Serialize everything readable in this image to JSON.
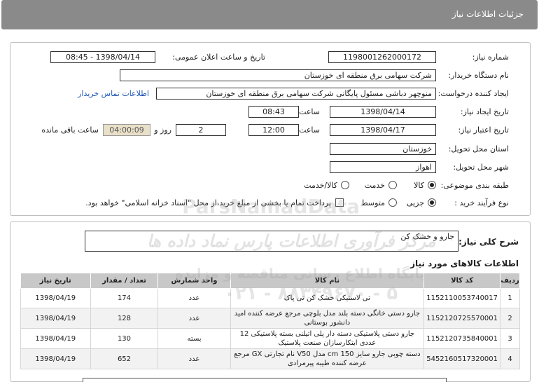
{
  "header": {
    "title": "جزئیات اطلاعات نیاز"
  },
  "form": {
    "need_number_label": "شماره نیاز:",
    "need_number": "1198001262000172",
    "announce_label": "تاریخ و ساعت اعلان عمومی:",
    "announce_value": "1398/04/14 - 08:45",
    "buyer_label": "نام دستگاه خریدار:",
    "buyer_value": "شرکت سهامی برق منطقه ای خوزستان",
    "creator_label": "ایجاد کننده درخواست:",
    "creator_value": "منوچهر دباشی مسئول پایگانی شرکت سهامی برق منطقه ای خوزستان",
    "contact_link": "اطلاعات تماس خریدار",
    "create_date_label": "تاریخ ایجاد نیاز:",
    "create_date": "1398/04/14",
    "time_label": "ساعت",
    "create_time": "08:43",
    "valid_label": "تاریخ اعتبار نیاز:",
    "valid_date": "1398/04/17",
    "valid_time": "12:00",
    "days_value": "2",
    "days_label": "روز و",
    "remaining_value": "04:00:09",
    "remaining_label": "ساعت باقی مانده",
    "province_label": "استان محل تحویل:",
    "province_value": "خوزستان",
    "city_label": "شهر محل تحویل:",
    "city_value": "اهواز",
    "category_label": "طبقه بندی موضوعی:",
    "category_options": [
      "کالا",
      "خدمت",
      "کالا/خدمت"
    ],
    "process_label": "نوع فرآیند خرید :",
    "process_options": [
      "جزیی",
      "متوسط"
    ],
    "payment_note": "پرداخت تمام یا بخشی از مبلغ خرید،از محل \"اسناد خزانه اسلامی\" خواهد بود."
  },
  "summary": {
    "label": "شرح کلی نیاز:",
    "value": "جارو و خشک کن"
  },
  "items_section": {
    "title": "اطلاعات کالاهای مورد نیاز",
    "columns": [
      "ردیف",
      "کد کالا",
      "نام کالا",
      "واحد شمارش",
      "تعداد / مقدار",
      "تاریخ نیاز"
    ],
    "rows": [
      [
        "1",
        "1152110053740017",
        "تی لاستیکی خشک کن تی پاک",
        "عدد",
        "174",
        "1398/04/19"
      ],
      [
        "2",
        "1152120725570001",
        "جارو دستی خانگی دسته بلند مدل بلوچی مرجع عرضه کننده امید دانشور بوستانی",
        "عدد",
        "128",
        "1398/04/19"
      ],
      [
        "3",
        "1152120735840001",
        "جارو دستی پلاستیکی دسته دار پلی اتیلنی بسته پلاستیکی 12 عددی ابتکارسازان صنعت پلاستیک",
        "بسته",
        "130",
        "1398/04/19"
      ],
      [
        "4",
        "5452160517320001",
        "دسته چوبی جارو سایز 150 cm مدل V50 نام تجارتی GX مرجع عرضه کننده طیبه پیرمرادی",
        "عدد",
        "652",
        "1398/04/19"
      ]
    ]
  },
  "watermark": {
    "line1": "ParsNamadData",
    "line2": "مرکز فرآوری اطلاعات پارس نماد داده ها",
    "line3": "پایگاه اطلاع رسانی مناقصه و مزایده",
    "line4": "۰۲۱ - ۸۸۳۴۹۶۷۰ - ۵"
  }
}
